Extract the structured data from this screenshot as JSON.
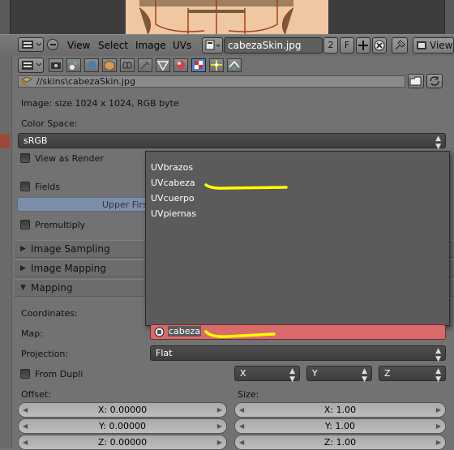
{
  "header": {
    "menus": [
      "View",
      "Select",
      "Image",
      "UVs"
    ],
    "image_name": "cabezaSkin.jpg",
    "users": "2",
    "fake": "F",
    "right_view": "View"
  },
  "image": {
    "path": "//skins\\cabezaSkin.jpg",
    "info": "Image: size 1024 x 1024, RGB byte",
    "color_space_label": "Color Space:",
    "color_space": "sRGB"
  },
  "options": {
    "view_as_render": "View as Render",
    "fields": "Fields",
    "field_order": "Upper First",
    "premultiply": "Premultiply"
  },
  "subpanels": {
    "image_sampling": "Image Sampling",
    "image_mapping": "Image Mapping",
    "mapping": "Mapping"
  },
  "mapping": {
    "coordinates_label": "Coordinates:",
    "map_label": "Map:",
    "map_value": "cabeza",
    "projection_label": "Projection:",
    "projection": "Flat",
    "from_dupli": "From Dupli",
    "axes": [
      "X",
      "Y",
      "Z"
    ],
    "offset_label": "Offset:",
    "size_label": "Size:",
    "offset": [
      "X: 0.00000",
      "Y: 0.00000",
      "Z: 0.00000"
    ],
    "size": [
      "X: 1.00",
      "Y: 1.00",
      "Z: 1.00"
    ]
  },
  "uv_popup": {
    "items": [
      "UVbrazos",
      "UVcabeza",
      "UVcuerpo",
      "UVpiernas"
    ]
  },
  "colors": {
    "highlight": "#ffff00",
    "map_field": "#d86a6a",
    "popup_bg": "#5b5b5b"
  }
}
